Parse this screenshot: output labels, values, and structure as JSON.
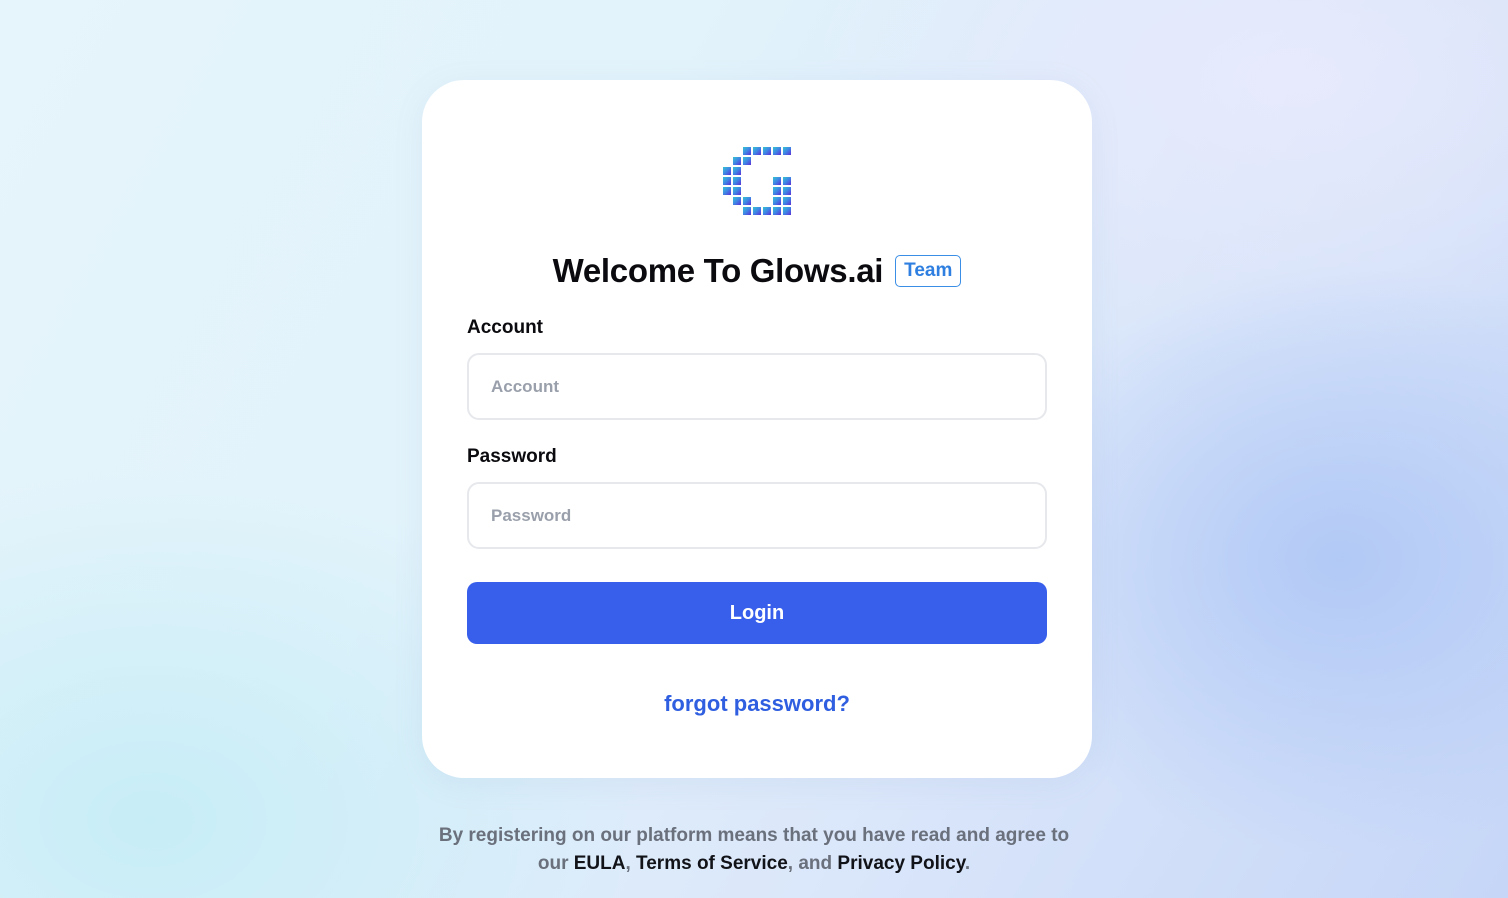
{
  "app": {
    "logo_icon": "glows-pixel-g-logo-icon",
    "title": "Welcome To Glows.ai",
    "badge": "Team"
  },
  "form": {
    "account_label": "Account",
    "account_placeholder": "Account",
    "password_label": "Password",
    "password_placeholder": "Password",
    "login_label": "Login",
    "forgot_label": "forgot password?"
  },
  "footer": {
    "line1": "By registering on our platform means that you have read and agree to",
    "prefix": "our ",
    "eula": "EULA",
    "sep1": ", ",
    "terms": "Terms of Service",
    "sep2": ", and ",
    "privacy": "Privacy Policy",
    "suffix": "."
  },
  "colors": {
    "primary": "#385fec",
    "link": "#2f5fe0",
    "badge": "#2f7fe0",
    "logo_gradient_start": "#3ab8d6",
    "logo_gradient_end": "#5b2fd6"
  }
}
